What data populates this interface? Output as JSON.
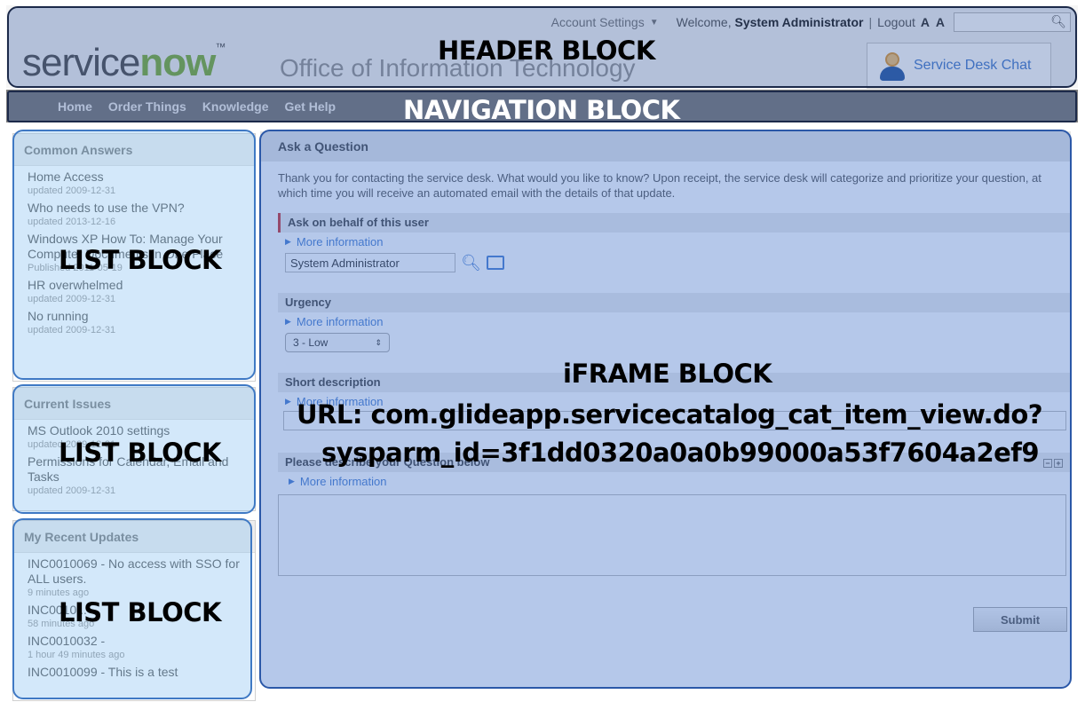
{
  "header": {
    "account_settings": "Account Settings",
    "welcome_prefix": "Welcome,",
    "welcome_user": "System Administrator",
    "logout": "Logout",
    "font_size": "A A",
    "logo_service": "service",
    "logo_now": "now",
    "logo_tm": "™",
    "org_title": "Office of Information Technology",
    "chat_button": "Service Desk Chat"
  },
  "nav": {
    "items": [
      "Home",
      "Order Things",
      "Knowledge",
      "Get Help"
    ]
  },
  "common_answers": {
    "title": "Common Answers",
    "items": [
      {
        "title": "Home Access",
        "date": "updated 2009-12-31"
      },
      {
        "title": "Who needs to use the VPN?",
        "date": "updated 2013-12-16"
      },
      {
        "title": "Windows XP How To: Manage Your Computer Documents in One Place",
        "date": "Published 2011-05-19"
      },
      {
        "title": "HR overwhelmed",
        "date": "updated 2009-12-31"
      },
      {
        "title": "No running",
        "date": "updated 2009-12-31"
      }
    ]
  },
  "current_issues": {
    "title": "Current Issues",
    "items": [
      {
        "title": "MS Outlook 2010 settings",
        "date": "updated 2009-12-31"
      },
      {
        "title": "Permissions for Calendar, Email and Tasks",
        "date": "updated 2009-12-31"
      }
    ]
  },
  "recent_updates": {
    "title": "My Recent Updates",
    "items": [
      {
        "title": "INC0010069 - No access with SSO for ALL users.",
        "date": "9 minutes ago"
      },
      {
        "title": "INC0010...",
        "date": "58 minutes ago"
      },
      {
        "title": "INC0010032 -",
        "date": "1 hour 49 minutes ago"
      },
      {
        "title": "INC0010099 - This is a test",
        "date": ""
      }
    ]
  },
  "form": {
    "title": "Ask a Question",
    "intro": "Thank you for contacting the service desk. What would you like to know? Upon receipt, the service desk will categorize and prioritize your question, at which time you will receive an automated email with the details of that update.",
    "behalf_label": "Ask on behalf of this user",
    "more_info": "More information",
    "behalf_value": "System Administrator",
    "urgency_label": "Urgency",
    "urgency_value": "3 - Low",
    "short_desc_label": "Short description",
    "describe_label": "Please describe your Question below",
    "submit": "Submit"
  },
  "annotations": {
    "header_block": "HEADER BLOCK",
    "navigation_block": "NAVIGATION BLOCK",
    "list_block": "LIST BLOCK",
    "iframe_block": "iFRAME BLOCK",
    "iframe_url_line1": "URL: com.glideapp.servicecatalog_cat_item_view.do?",
    "iframe_url_line2": "sysparm_id=3f1dd0320a0a0b99000a53f7604a2ef9"
  },
  "colors": {
    "overlay_dark": "#1c2a4a",
    "overlay_list": "#3f79c4",
    "nav_bg": "#7e7e7e",
    "link_blue": "#4a7fd0",
    "logo_green": "#81b441"
  }
}
